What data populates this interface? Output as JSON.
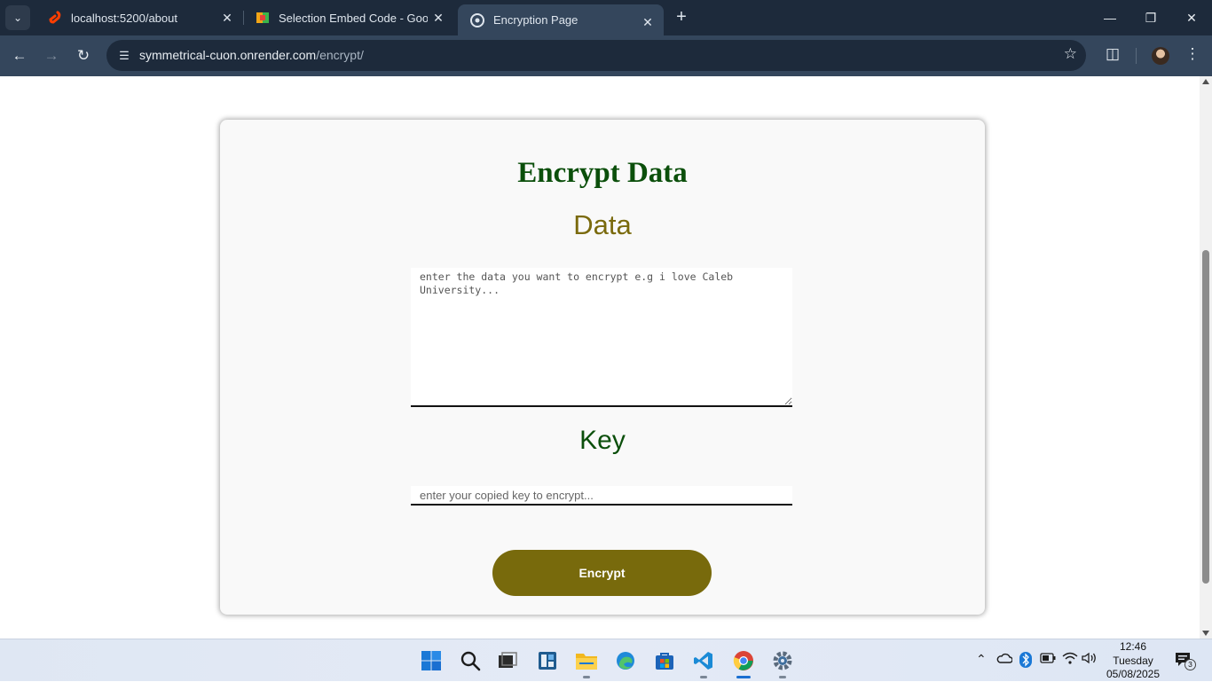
{
  "browser": {
    "tabs": [
      {
        "title": "localhost:5200/about",
        "favicon": "svelte-icon",
        "active": false
      },
      {
        "title": "Selection Embed Code - Google",
        "favicon": "yb-icon",
        "active": false
      },
      {
        "title": "Encryption Page",
        "favicon": "chrome-icon",
        "active": true
      }
    ],
    "url": {
      "host": "symmetrical-cuon.onrender.com",
      "path": "/encrypt/"
    }
  },
  "page": {
    "heading": "Encrypt Data",
    "data_label": "Data",
    "data_placeholder": "enter the data you want to encrypt e.g i love Caleb University...",
    "key_label": "Key",
    "key_placeholder": "enter your copied key to encrypt...",
    "encrypt_button": "Encrypt"
  },
  "taskbar": {
    "clock": {
      "time": "12:46",
      "day": "Tuesday",
      "date": "05/08/2025"
    },
    "notification_count": "3"
  },
  "colors": {
    "heading": "#0b4f0b",
    "data_label": "#7a6a0d",
    "button_bg": "#786a0c",
    "chrome_dark": "#1d2a3b",
    "chrome_toolbar": "#34465c"
  }
}
